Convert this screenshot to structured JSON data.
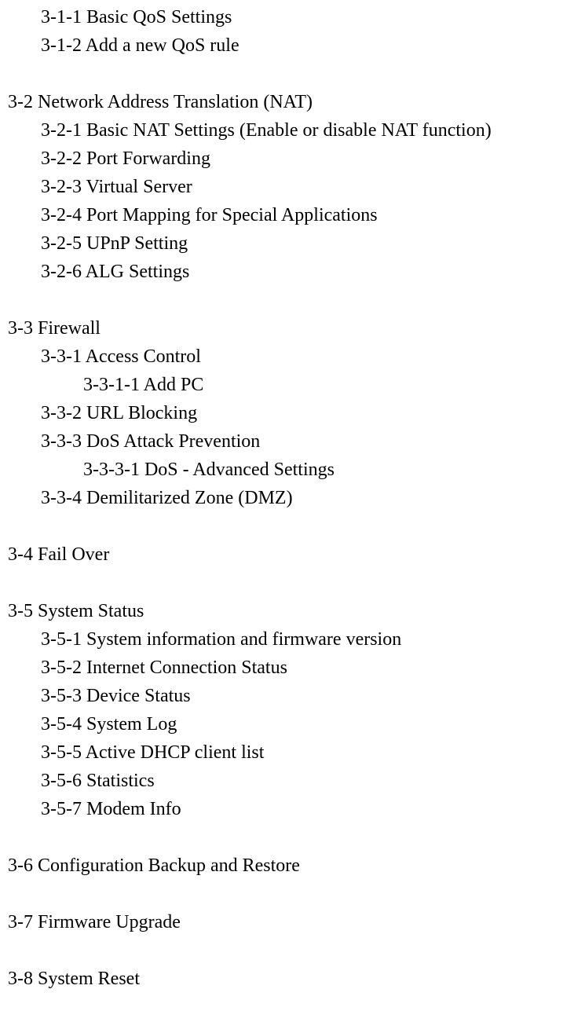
{
  "lines": {
    "l0": "3-1-1 Basic QoS Settings",
    "l1": "3-1-2 Add a new QoS rule",
    "l2": "3-2 Network Address Translation (NAT)",
    "l3": "3-2-1 Basic NAT Settings (Enable or disable NAT function)",
    "l4": "3-2-2 Port Forwarding",
    "l5": "3-2-3 Virtual Server",
    "l6": "3-2-4 Port Mapping for Special Applications",
    "l7": "3-2-5 UPnP Setting",
    "l8": "3-2-6 ALG Settings",
    "l9": "3-3 Firewall",
    "l10": "3-3-1 Access Control",
    "l11": "3-3-1-1 Add PC",
    "l12": "3-3-2 URL Blocking",
    "l13": "3-3-3 DoS Attack Prevention",
    "l14": "3-3-3-1 DoS - Advanced Settings",
    "l15": "3-3-4 Demilitarized Zone (DMZ)",
    "l16": "3-4 Fail Over",
    "l17": "3-5 System Status",
    "l18": "3-5-1 System information and firmware version",
    "l19": "3-5-2 Internet Connection Status",
    "l20": "3-5-3 Device Status",
    "l21": "3-5-4 System Log",
    "l22": "3-5-5 Active DHCP client list",
    "l23": "3-5-6 Statistics",
    "l24": "3-5-7 Modem Info",
    "l25": "3-6 Configuration Backup and Restore",
    "l26": "3-7 Firmware Upgrade",
    "l27": "3-8 System Reset"
  }
}
